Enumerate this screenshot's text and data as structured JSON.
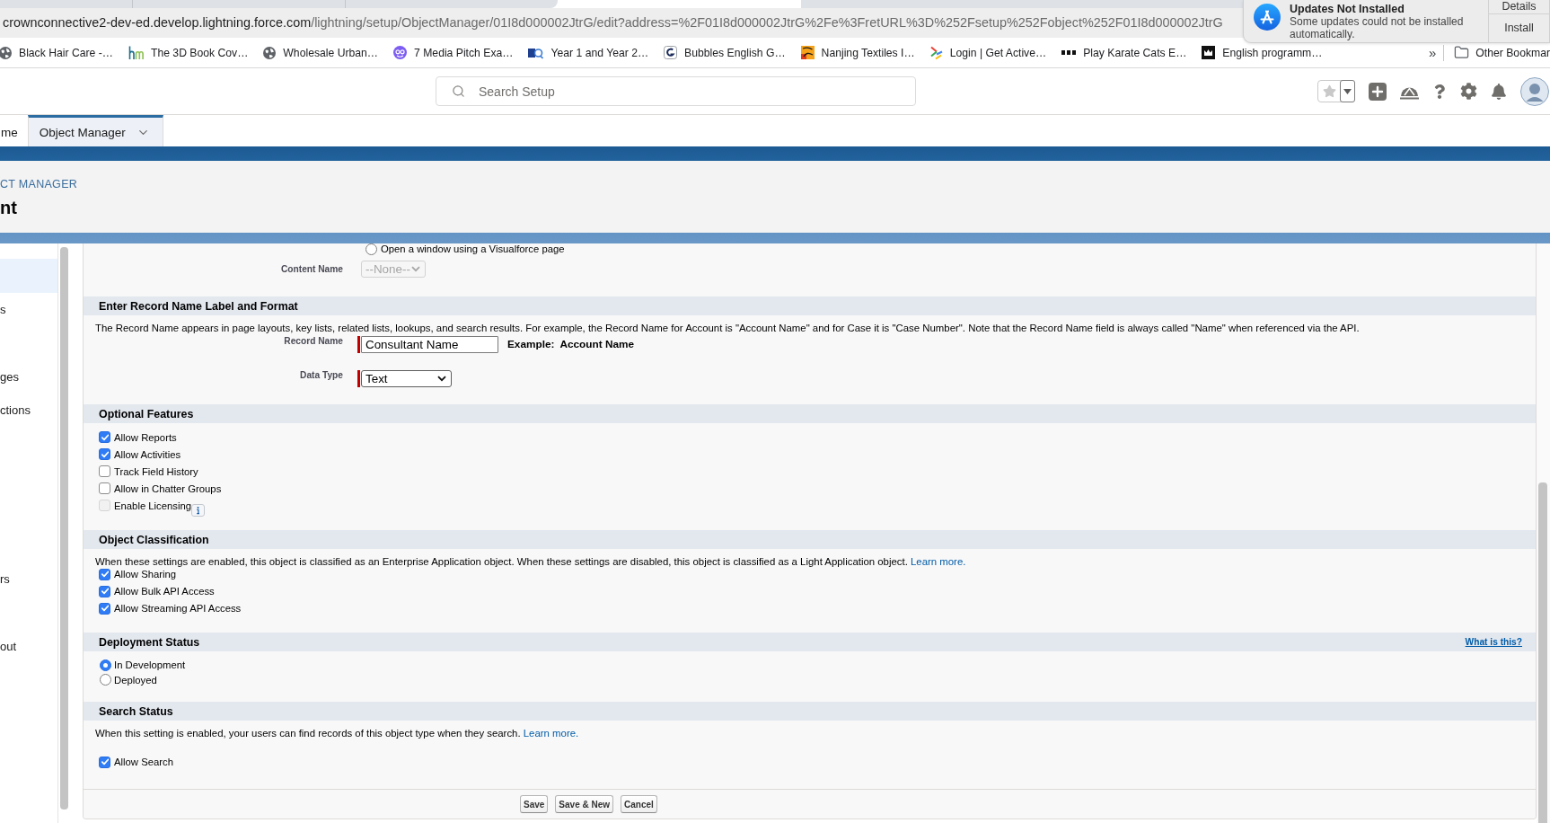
{
  "browser": {
    "url": {
      "host": "crownconnective2-dev-ed.develop.lightning.force.com",
      "path": "/lightning/setup/ObjectManager/01I8d000002JtrG/edit?address=%2F01I8d000002JtrG%2Fe%3FretURL%3D%252Fsetup%252Fobject%252F01I8d000002JtrG"
    },
    "bookmarks": [
      {
        "label": "Black Hair Care -…"
      },
      {
        "label": "The 3D Book Cov…"
      },
      {
        "label": "Wholesale Urban…"
      },
      {
        "label": "7 Media Pitch Exa…"
      },
      {
        "label": "Year 1 and Year 2…"
      },
      {
        "label": "Bubbles English G…"
      },
      {
        "label": "Nanjing Textiles I…"
      },
      {
        "label": "Login | Get Active…"
      },
      {
        "label": "Play Karate Cats E…"
      },
      {
        "label": "English programm…"
      }
    ],
    "overflow": "»",
    "other_bookmarks": "Other Bookmar"
  },
  "notification": {
    "title": "Updates Not Installed",
    "message": "Some updates could not be installed automatically.",
    "actions": [
      "Details",
      "Install"
    ]
  },
  "header": {
    "search": {
      "placeholder": "Search Setup"
    }
  },
  "nav_tabs": [
    {
      "label": "me",
      "selected": false,
      "dropdown": false
    },
    {
      "label": "Object Manager",
      "selected": true,
      "dropdown": true
    }
  ],
  "page_header": {
    "breadcrumb": "CT MANAGER",
    "title": "nt"
  },
  "sidebar": {
    "items": [
      {
        "selected": true
      },
      {
        "label": "s",
        "selected": false
      },
      {
        "label": "ges",
        "selected": false
      },
      {
        "label": "ctions",
        "selected": false
      },
      {
        "label": "rs",
        "selected": false
      },
      {
        "label": "out",
        "selected": false
      }
    ]
  },
  "form": {
    "visualforce_option": {
      "label": "Open a window using a Visualforce page",
      "selected": false
    },
    "content_name": {
      "label": "Content Name",
      "value": "--None--",
      "disabled": true
    },
    "sections": [
      {
        "kind": "fields",
        "title": "Enter Record Name Label and Format",
        "description": "The Record Name appears in page layouts, key lists, related lists, lookups, and search results. For example, the Record Name for Account is \"Account Name\" and for Case it is \"Case Number\". Note that the Record Name field is always called \"Name\" when referenced via the API.",
        "fields": [
          {
            "kind": "text",
            "label": "Record Name",
            "value": "Consultant Name",
            "required": true,
            "example_label": "Example:",
            "example_value": "Account Name"
          },
          {
            "kind": "select",
            "label": "Data Type",
            "value": "Text",
            "required": true
          }
        ]
      },
      {
        "kind": "checkboxes",
        "title": "Optional Features",
        "options": [
          {
            "label": "Allow Reports",
            "checked": true,
            "disabled": false,
            "info": false
          },
          {
            "label": "Allow Activities",
            "checked": true,
            "disabled": false,
            "info": false
          },
          {
            "label": "Track Field History",
            "checked": false,
            "disabled": false,
            "info": false
          },
          {
            "label": "Allow in Chatter Groups",
            "checked": false,
            "disabled": false,
            "info": false
          },
          {
            "label": "Enable Licensing",
            "checked": false,
            "disabled": true,
            "info": true
          }
        ]
      },
      {
        "kind": "checkboxes",
        "title": "Object Classification",
        "description": "When these settings are enabled, this object is classified as an Enterprise Application object. When these settings are disabled, this object is classified as a Light Application object.",
        "link": "Learn more.",
        "options": [
          {
            "label": "Allow Sharing",
            "checked": true,
            "disabled": false
          },
          {
            "label": "Allow Bulk API Access",
            "checked": true,
            "disabled": false
          },
          {
            "label": "Allow Streaming API Access",
            "checked": true,
            "disabled": false
          }
        ]
      },
      {
        "kind": "radios",
        "title": "Deployment Status",
        "help_link": "What is this?",
        "options": [
          {
            "label": "In Development",
            "selected": true
          },
          {
            "label": "Deployed",
            "selected": false
          }
        ]
      },
      {
        "kind": "checkboxes",
        "title": "Search Status",
        "description": "When this setting is enabled, your users can find records of this object type when they search.",
        "link": "Learn more.",
        "options": [
          {
            "label": "Allow Search",
            "checked": true,
            "disabled": false
          }
        ]
      }
    ],
    "buttons": [
      "Save",
      "Save & New",
      "Cancel"
    ]
  }
}
